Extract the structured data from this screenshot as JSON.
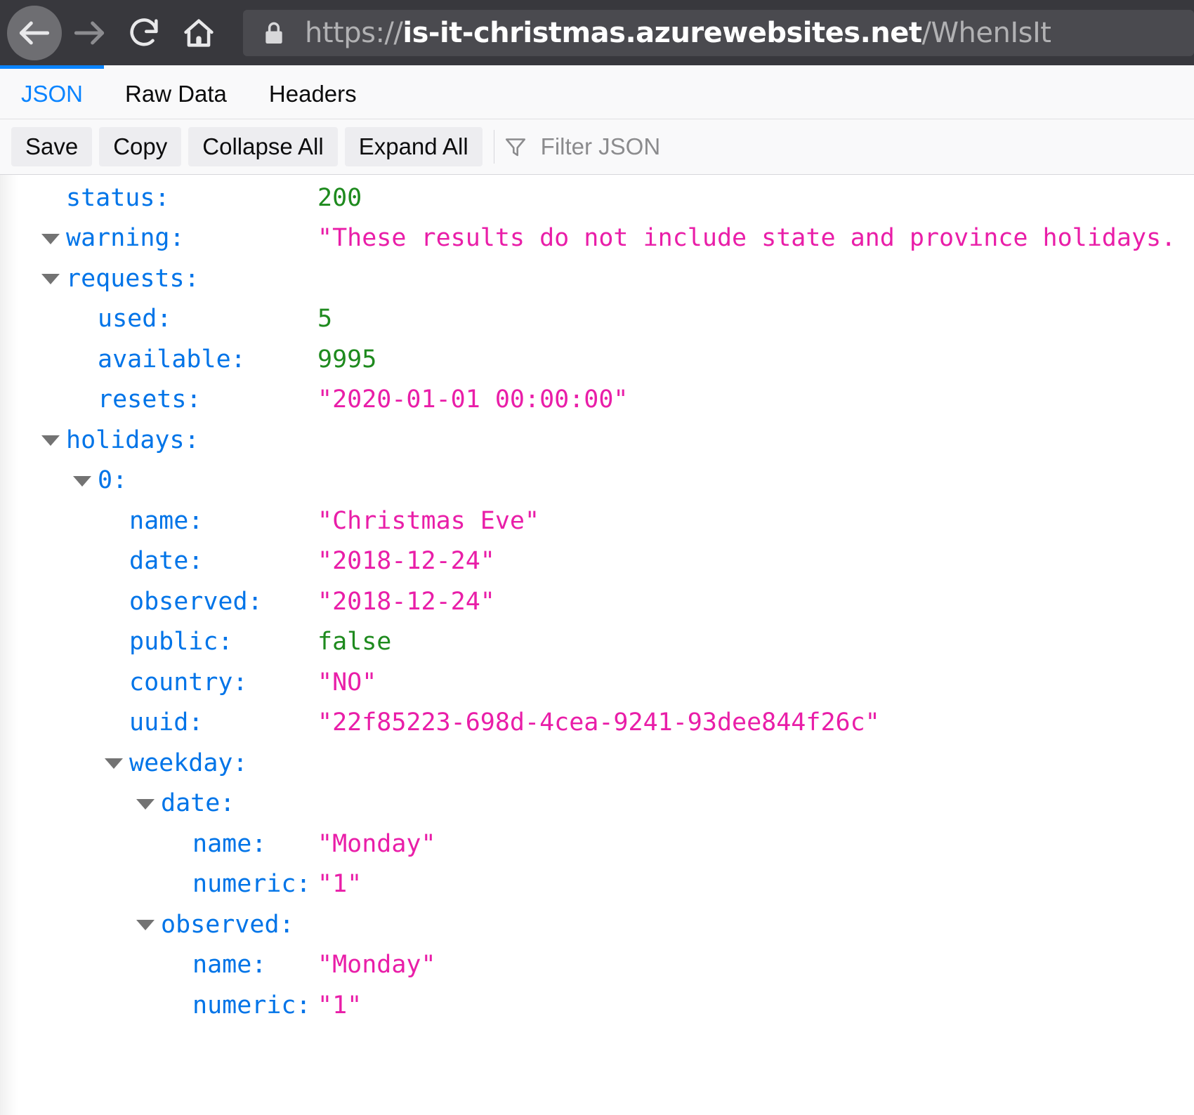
{
  "browser": {
    "nav": {
      "back_label": "Back",
      "forward_label": "Forward",
      "reload_label": "Reload",
      "home_label": "Home"
    },
    "url": {
      "prefix": "https://",
      "host": "is-it-christmas.azurewebsites.net",
      "path": "/WhenIsIt",
      "full": "https://is-it-christmas.azurewebsites.net/WhenIsIt",
      "secure_icon": "lock-icon"
    }
  },
  "viewer": {
    "tabs": [
      {
        "label": "JSON",
        "active": true
      },
      {
        "label": "Raw Data",
        "active": false
      },
      {
        "label": "Headers",
        "active": false
      }
    ],
    "toolbar": {
      "save_label": "Save",
      "copy_label": "Copy",
      "collapse_all_label": "Collapse All",
      "expand_all_label": "Expand All",
      "filter_placeholder": "Filter JSON",
      "filter_icon": "funnel-icon"
    },
    "colors": {
      "key": "#0074e8",
      "string": "#e91ea8",
      "number": "#1e8a1e",
      "boolean": "#1e8a1e",
      "accent": "#0a84ff",
      "twisty": "#737373"
    }
  },
  "json_rows": [
    {
      "indent": 1,
      "twisty": false,
      "key": "status:",
      "value": "200",
      "type": "num"
    },
    {
      "indent": 1,
      "twisty": true,
      "key": "warning:",
      "value": "\"These results do not include state and province holidays.",
      "type": "str"
    },
    {
      "indent": 1,
      "twisty": true,
      "key": "requests:",
      "value": "",
      "type": "none"
    },
    {
      "indent": 2,
      "twisty": false,
      "key": "used:",
      "value": "5",
      "type": "num"
    },
    {
      "indent": 2,
      "twisty": false,
      "key": "available:",
      "value": "9995",
      "type": "num"
    },
    {
      "indent": 2,
      "twisty": false,
      "key": "resets:",
      "value": "\"2020-01-01 00:00:00\"",
      "type": "str"
    },
    {
      "indent": 1,
      "twisty": true,
      "key": "holidays:",
      "value": "",
      "type": "none"
    },
    {
      "indent": 2,
      "twisty": true,
      "key": "0:",
      "value": "",
      "type": "none"
    },
    {
      "indent": 3,
      "twisty": false,
      "key": "name:",
      "value": "\"Christmas Eve\"",
      "type": "str"
    },
    {
      "indent": 3,
      "twisty": false,
      "key": "date:",
      "value": "\"2018-12-24\"",
      "type": "str"
    },
    {
      "indent": 3,
      "twisty": false,
      "key": "observed:",
      "value": "\"2018-12-24\"",
      "type": "str"
    },
    {
      "indent": 3,
      "twisty": false,
      "key": "public:",
      "value": "false",
      "type": "bool"
    },
    {
      "indent": 3,
      "twisty": false,
      "key": "country:",
      "value": "\"NO\"",
      "type": "str"
    },
    {
      "indent": 3,
      "twisty": false,
      "key": "uuid:",
      "value": "\"22f85223-698d-4cea-9241-93dee844f26c\"",
      "type": "str"
    },
    {
      "indent": 3,
      "twisty": true,
      "key": "weekday:",
      "value": "",
      "type": "none"
    },
    {
      "indent": 4,
      "twisty": true,
      "key": "date:",
      "value": "",
      "type": "none"
    },
    {
      "indent": 5,
      "twisty": false,
      "key": "name:",
      "value": "\"Monday\"",
      "type": "str"
    },
    {
      "indent": 5,
      "twisty": false,
      "key": "numeric:",
      "value": "\"1\"",
      "type": "str"
    },
    {
      "indent": 4,
      "twisty": true,
      "key": "observed:",
      "value": "",
      "type": "none"
    },
    {
      "indent": 5,
      "twisty": false,
      "key": "name:",
      "value": "\"Monday\"",
      "type": "str"
    },
    {
      "indent": 5,
      "twisty": false,
      "key": "numeric:",
      "value": "\"1\"",
      "type": "str"
    }
  ]
}
